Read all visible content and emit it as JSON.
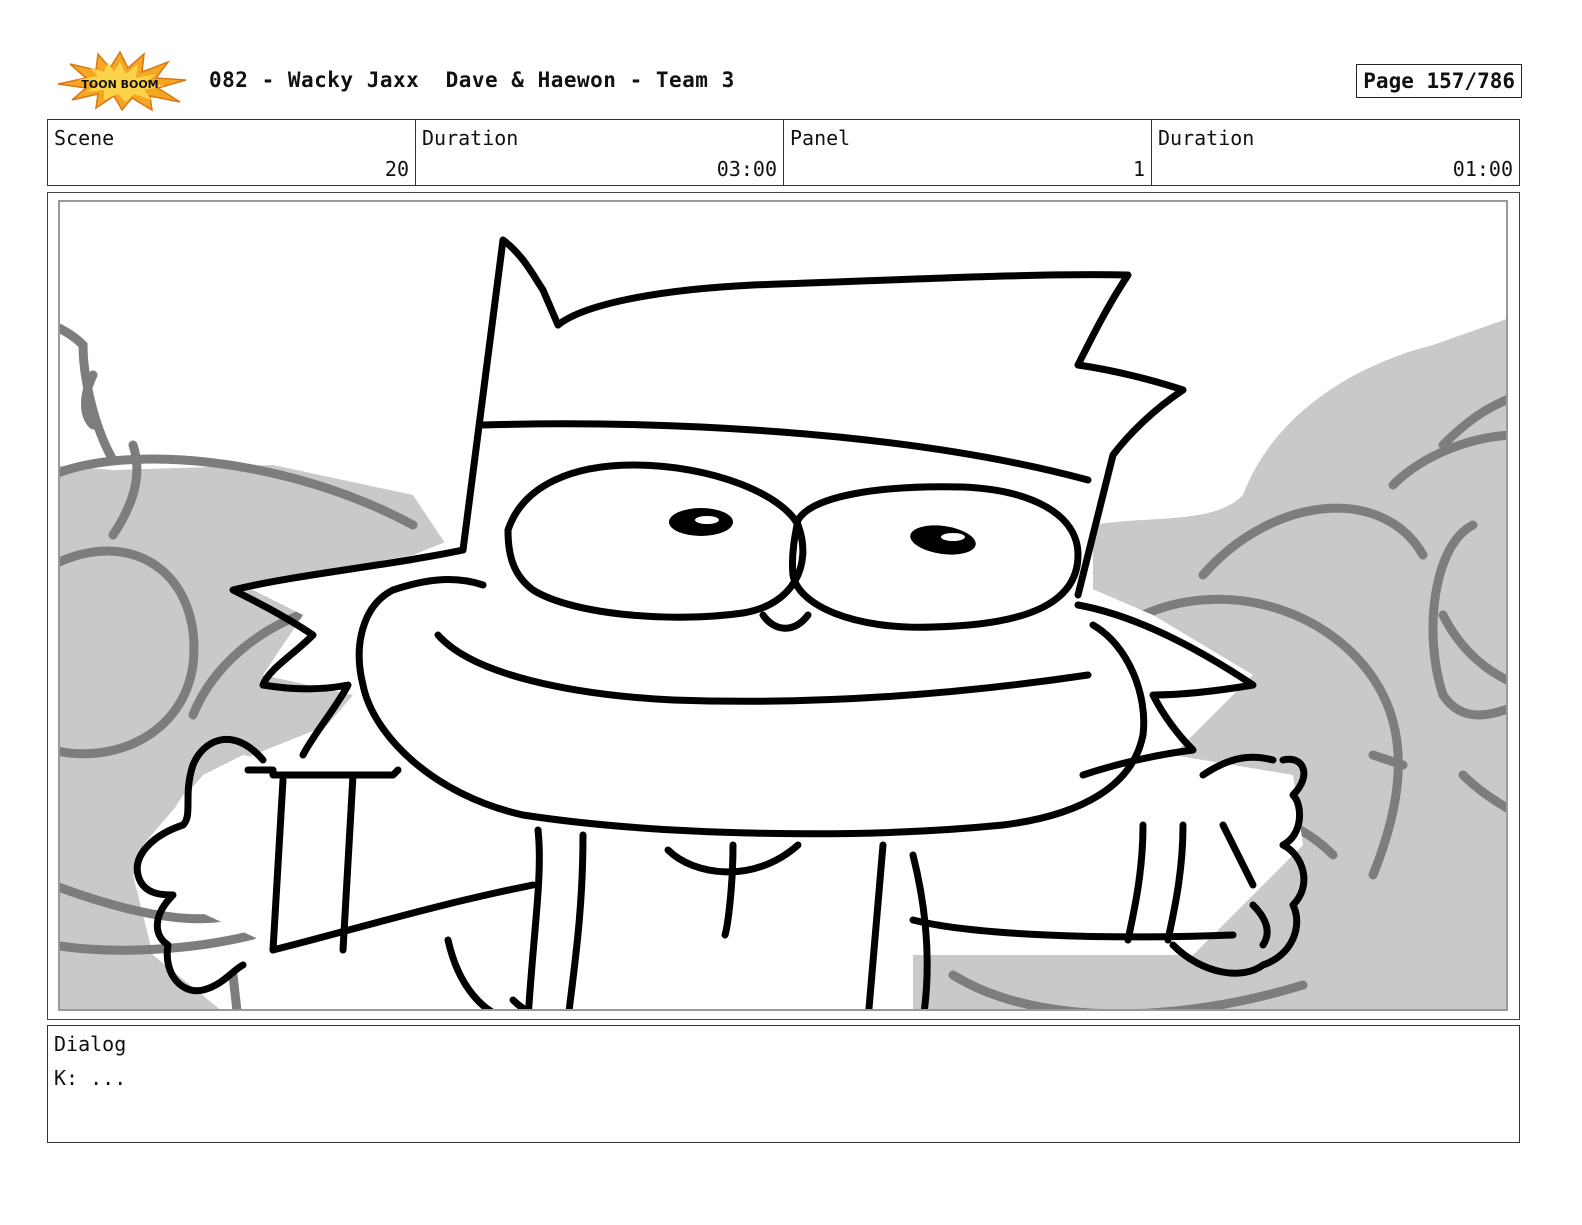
{
  "header": {
    "logo_text": "TOON BOOM",
    "title": "082 - Wacky Jaxx  Dave & Haewon - Team 3",
    "page": "Page 157/786"
  },
  "info": {
    "scene_label": "Scene",
    "scene_value": "20",
    "scene_duration_label": "Duration",
    "scene_duration_value": "03:00",
    "panel_label": "Panel",
    "panel_value": "1",
    "panel_duration_label": "Duration",
    "panel_duration_value": "01:00"
  },
  "dialog": {
    "label": "Dialog",
    "line": "K: ..."
  },
  "colors": {
    "logo_orange": "#f5a623",
    "background_gray": "#c9c9c9",
    "sketch_gray": "#7d7d7d",
    "ink": "#000000"
  }
}
